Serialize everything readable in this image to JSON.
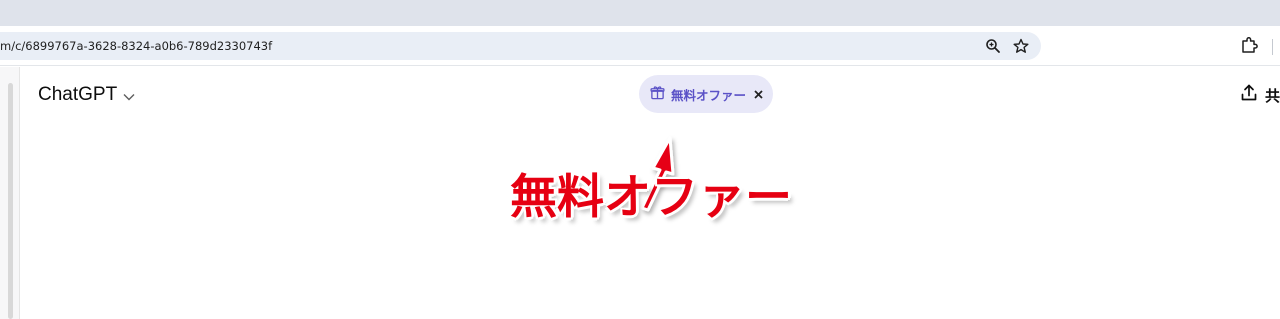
{
  "browser": {
    "url": "m/c/6899767a-3628-8324-a0b6-789d2330743f",
    "icons": [
      "zoom-icon",
      "bookmark-star-icon",
      "extensions-icon"
    ]
  },
  "chat_header": {
    "model_label": "ChatGPT",
    "offer_label": "無料オファー",
    "share_label": "共"
  },
  "annotation": {
    "text": "無料オファー",
    "color": "#e60012"
  },
  "colors": {
    "offer_text": "#5b52c7",
    "offer_bg": "#e8e8f8",
    "tabstrip": "#dfe3eb",
    "omnibox": "#e9eef6"
  }
}
